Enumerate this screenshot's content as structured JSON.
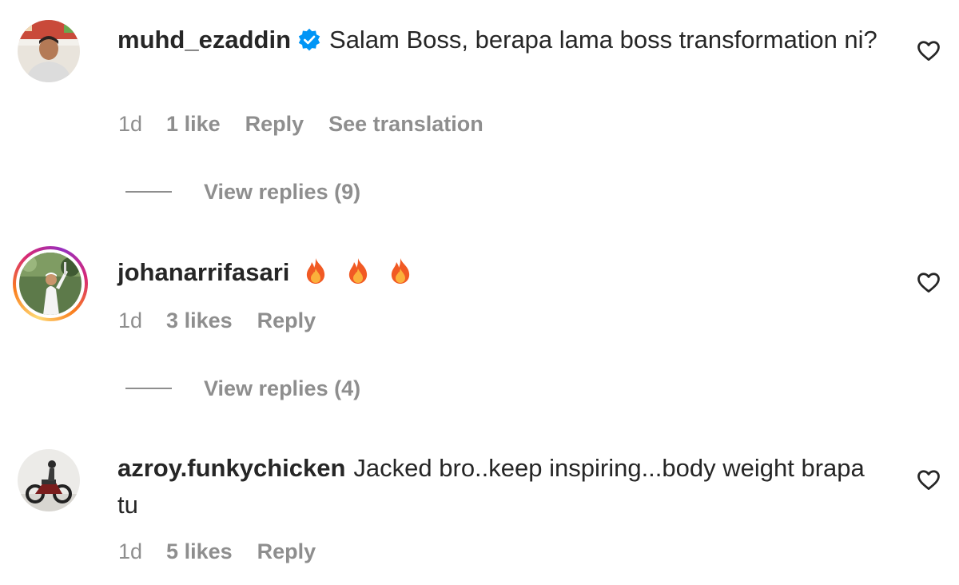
{
  "comments": [
    {
      "username": "muhd_ezaddin",
      "verified": true,
      "text": "Salam Boss, berapa lama boss transformation ni?",
      "time": "1d",
      "likes": "1 like",
      "reply_label": "Reply",
      "translate_label": "See translation",
      "view_replies": "View replies (9)",
      "avatar_icon": "profile-photo"
    },
    {
      "username": "johanarrifasari",
      "verified": false,
      "has_story": true,
      "emoji": [
        "fire-icon",
        "fire-icon",
        "fire-icon"
      ],
      "time": "1d",
      "likes": "3 likes",
      "reply_label": "Reply",
      "view_replies": "View replies (4)",
      "avatar_icon": "profile-photo"
    },
    {
      "username": "azroy.funkychicken",
      "verified": false,
      "text": "Jacked bro..keep inspiring...body weight brapa tu",
      "time": "1d",
      "likes": "5 likes",
      "reply_label": "Reply",
      "avatar_icon": "profile-photo"
    }
  ],
  "colors": {
    "text": "#262626",
    "meta": "#8e8e8e",
    "verified": "#0095f6",
    "story_ring": [
      "#feda75",
      "#fa7e1e",
      "#d62976",
      "#962fbf"
    ]
  },
  "icons": {
    "like": "heart-outline-icon",
    "verified": "verified-badge-icon",
    "reaction": "fire-icon"
  }
}
